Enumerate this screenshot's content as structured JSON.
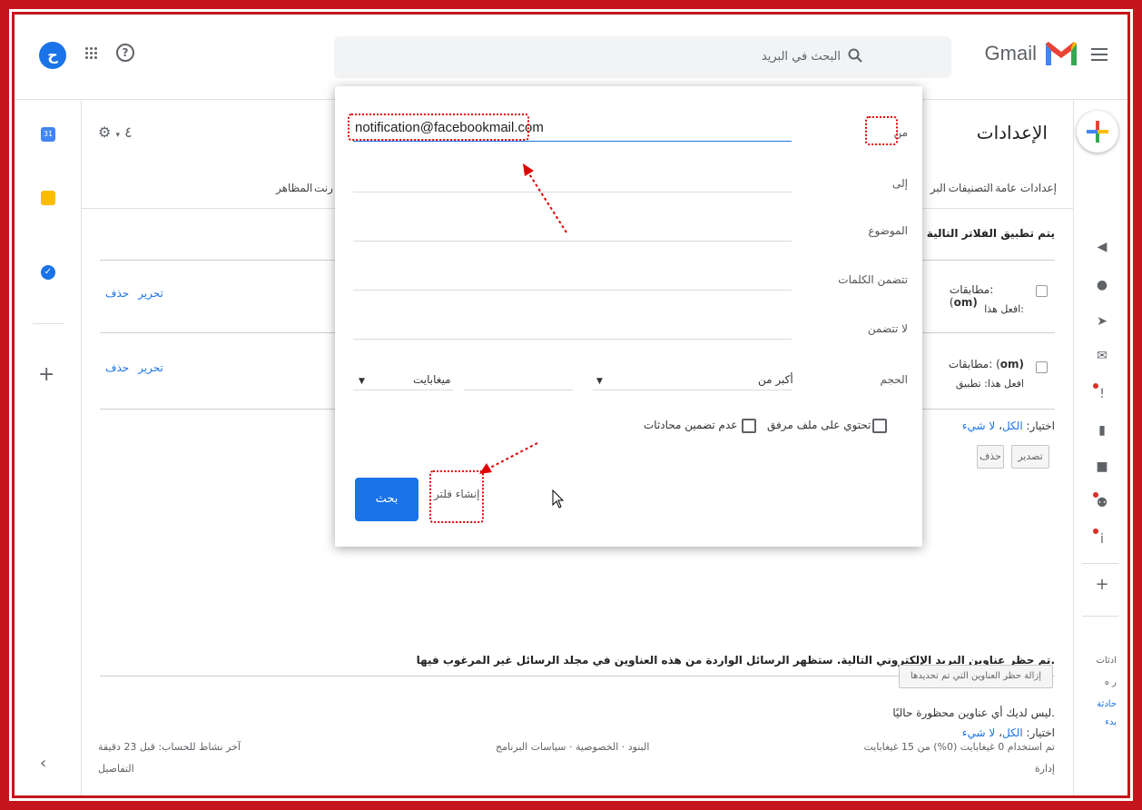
{
  "header": {
    "app_name": "Gmail",
    "search_placeholder": "البحث في البريد",
    "avatar_letter": "ح"
  },
  "left_rail": {
    "calendar_day": "31",
    "tasks_glyph": "✓"
  },
  "settings": {
    "title": "الإعدادات",
    "gear_label": "٤",
    "tabs": [
      "إعدادات عامة",
      "التصنيفات",
      "البر",
      "رنت",
      "المظاهر"
    ],
    "filters_heading": "يتم تطبيق الفلاتر التالية على كافة",
    "filters": [
      {
        "match_label": "مطابقات: (",
        "match_tail": "om)",
        "action_label": "افعل هذا:",
        "edit": "تحرير",
        "delete": "حذف"
      },
      {
        "match_label": "مطابقات: (",
        "match_tail": "om)",
        "action_label": "افعل هذا: تطبيق",
        "edit": "تحرير",
        "delete": "حذف"
      }
    ],
    "select_label": "اختيار:",
    "select_all": "الكل",
    "select_none": "لا شيء",
    "export_button": "تصدير",
    "delete_button": "حذف",
    "blocked_heading": "تم حظر عناوين البريد الإلكتروني التالية. ستظهر الرسائل الواردة من هذه العناوين في مجلد الرسائل غير المرغوب فيها.",
    "no_blocked": "ليس لديك أي عناوين محظورة حاليًا.",
    "select_label_2": "اختيار:",
    "select_all_2": "الكل",
    "select_none_2": "لا شيء",
    "unblock_button": "إزالة حظر العناوين التي تم تحديدها"
  },
  "footer": {
    "storage": "تم استخدام 0 غيغابايت (0%) من 15 غيغابايت",
    "manage": "إدارة",
    "links": "البنود · الخصوصية · سياسات البرنامج",
    "last_activity": "آخر نشاط للحساب: قبل 23 دقيقة",
    "details": "التفاصيل"
  },
  "right_rail": {
    "labels": [
      "ادثات",
      "ر ه",
      "حادثة",
      "بدء"
    ]
  },
  "dialog": {
    "from_label": "من",
    "from_value": "notification@facebookmail.com",
    "to_label": "إلى",
    "subject_label": "الموضوع",
    "has_words_label": "تتضمن الكلمات",
    "doesnt_have_label": "لا تتضمن",
    "size_label": "الحجم",
    "size_operator": "أكبر من",
    "size_unit": "ميغابايت",
    "has_attachment_label": "تحتوي على ملف مرفق",
    "no_chats_label": "عدم تضمين محادثات",
    "create_filter": "إنشاء فلتر",
    "search_button": "بحث"
  },
  "colors": {
    "frame_red": "#c4161c",
    "accent_blue": "#1a73e8",
    "annotation_red": "#e00000"
  }
}
